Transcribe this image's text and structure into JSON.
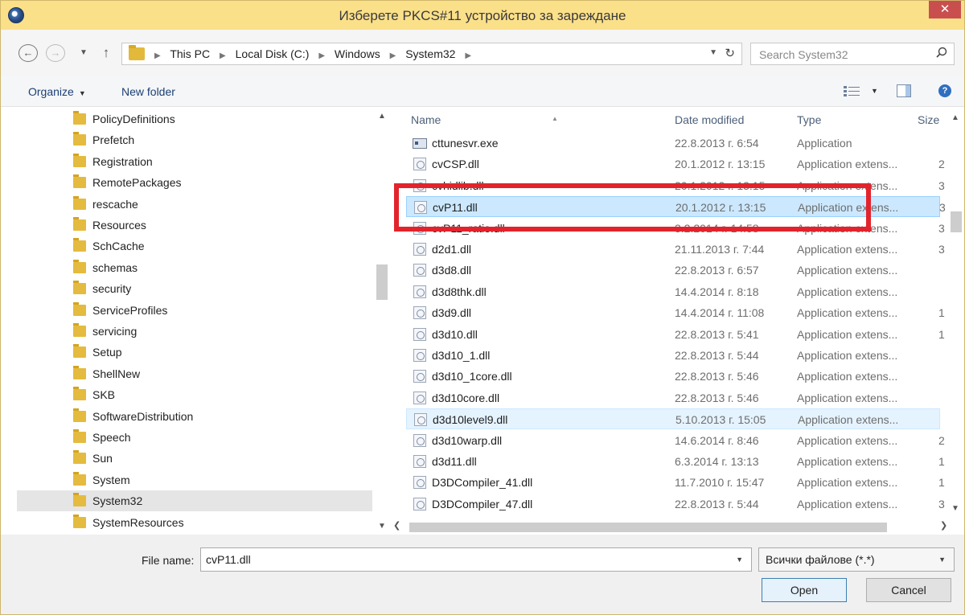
{
  "window": {
    "title": "Изберете PKCS#11 устройство за зареждане",
    "close_glyph": "✕"
  },
  "address": {
    "crumbs": [
      "This PC",
      "Local Disk (C:)",
      "Windows",
      "System32"
    ],
    "search_placeholder": "Search System32"
  },
  "toolbar": {
    "organize_label": "Organize",
    "new_folder_label": "New folder"
  },
  "nav_tree": {
    "items": [
      "PolicyDefinitions",
      "Prefetch",
      "Registration",
      "RemotePackages",
      "rescache",
      "Resources",
      "SchCache",
      "schemas",
      "security",
      "ServiceProfiles",
      "servicing",
      "Setup",
      "ShellNew",
      "SKB",
      "SoftwareDistribution",
      "Speech",
      "Sun",
      "System",
      "System32",
      "SystemResources"
    ],
    "selected": "System32"
  },
  "file_list": {
    "columns": {
      "name": "Name",
      "date": "Date modified",
      "type": "Type",
      "size": "Size"
    },
    "files": [
      {
        "name": "cttunesvr.exe",
        "date": "22.8.2013 г. 6:54",
        "type": "Application",
        "size": ""
      },
      {
        "name": "cvCSP.dll",
        "date": "20.1.2012 г. 13:15",
        "type": "Application extens...",
        "size": "2"
      },
      {
        "name": "cvhidlib.dll",
        "date": "20.1.2012 г. 13:15",
        "type": "Application extens...",
        "size": "3"
      },
      {
        "name": "cvP11.dll",
        "date": "20.1.2012 г. 13:15",
        "type": "Application extens...",
        "size": "3"
      },
      {
        "name": "cvP11_ratio.dll",
        "date": "3.2.2014 г. 14:58",
        "type": "Application extens...",
        "size": "3"
      },
      {
        "name": "d2d1.dll",
        "date": "21.11.2013 г. 7:44",
        "type": "Application extens...",
        "size": "3"
      },
      {
        "name": "d3d8.dll",
        "date": "22.8.2013 г. 6:57",
        "type": "Application extens...",
        "size": ""
      },
      {
        "name": "d3d8thk.dll",
        "date": "14.4.2014 г. 8:18",
        "type": "Application extens...",
        "size": ""
      },
      {
        "name": "d3d9.dll",
        "date": "14.4.2014 г. 11:08",
        "type": "Application extens...",
        "size": "1"
      },
      {
        "name": "d3d10.dll",
        "date": "22.8.2013 г. 5:41",
        "type": "Application extens...",
        "size": "1"
      },
      {
        "name": "d3d10_1.dll",
        "date": "22.8.2013 г. 5:44",
        "type": "Application extens...",
        "size": ""
      },
      {
        "name": "d3d10_1core.dll",
        "date": "22.8.2013 г. 5:46",
        "type": "Application extens...",
        "size": ""
      },
      {
        "name": "d3d10core.dll",
        "date": "22.8.2013 г. 5:46",
        "type": "Application extens...",
        "size": ""
      },
      {
        "name": "d3d10level9.dll",
        "date": "5.10.2013 г. 15:05",
        "type": "Application extens...",
        "size": ""
      },
      {
        "name": "d3d10warp.dll",
        "date": "14.6.2014 г. 8:46",
        "type": "Application extens...",
        "size": "2"
      },
      {
        "name": "d3d11.dll",
        "date": "6.3.2014 г. 13:13",
        "type": "Application extens...",
        "size": "1"
      },
      {
        "name": "D3DCompiler_41.dll",
        "date": "11.7.2010 г. 15:47",
        "type": "Application extens...",
        "size": "1"
      },
      {
        "name": "D3DCompiler_47.dll",
        "date": "22.8.2013 г. 5:44",
        "type": "Application extens...",
        "size": "3"
      }
    ],
    "selected": "cvP11.dll",
    "hovered": "d3d10level9.dll"
  },
  "bottom": {
    "file_name_label": "File name:",
    "file_name_value": "cvP11.dll",
    "filter_value": "Всички файлове (*.*)",
    "open_label": "Open",
    "cancel_label": "Cancel"
  },
  "colors": {
    "titlebar": "#fbe08a",
    "selection": "#cce8ff",
    "annotation_red": "#e3232c"
  }
}
